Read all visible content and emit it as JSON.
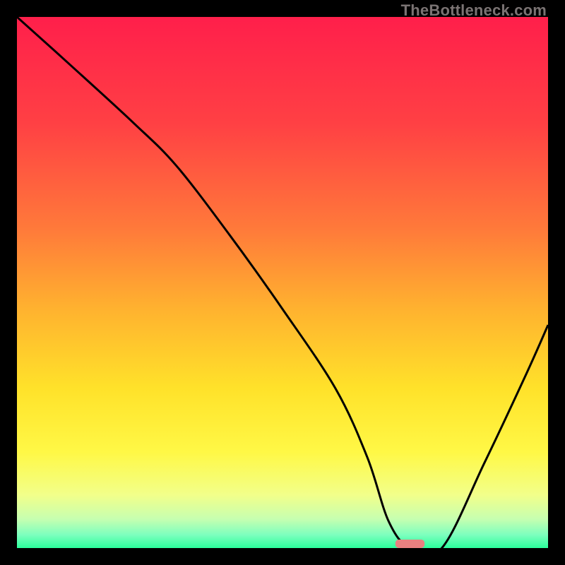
{
  "watermark": "TheBottleneck.com",
  "chart_data": {
    "type": "line",
    "title": "",
    "xlabel": "",
    "ylabel": "",
    "xlim": [
      0,
      100
    ],
    "ylim": [
      0,
      100
    ],
    "gradient_stops": [
      {
        "offset": 0.0,
        "color": "#ff1f4b"
      },
      {
        "offset": 0.2,
        "color": "#ff4044"
      },
      {
        "offset": 0.4,
        "color": "#ff7a3a"
      },
      {
        "offset": 0.55,
        "color": "#ffb22f"
      },
      {
        "offset": 0.7,
        "color": "#ffe22a"
      },
      {
        "offset": 0.82,
        "color": "#fff846"
      },
      {
        "offset": 0.9,
        "color": "#f2ff8a"
      },
      {
        "offset": 0.945,
        "color": "#c7ffb0"
      },
      {
        "offset": 0.975,
        "color": "#7dffbe"
      },
      {
        "offset": 1.0,
        "color": "#2bff9c"
      }
    ],
    "series": [
      {
        "name": "bottleneck-curve",
        "x": [
          0,
          10,
          22,
          30,
          40,
          50,
          60,
          66,
          70,
          74,
          80,
          88,
          96,
          100
        ],
        "y": [
          100,
          91,
          80,
          72,
          59,
          45,
          30,
          17,
          5,
          0,
          0,
          16,
          33,
          42
        ]
      }
    ],
    "marker": {
      "x": 74,
      "y": 0.8,
      "width_pct": 5.5,
      "height_pct": 1.6,
      "color": "#e98080"
    }
  }
}
